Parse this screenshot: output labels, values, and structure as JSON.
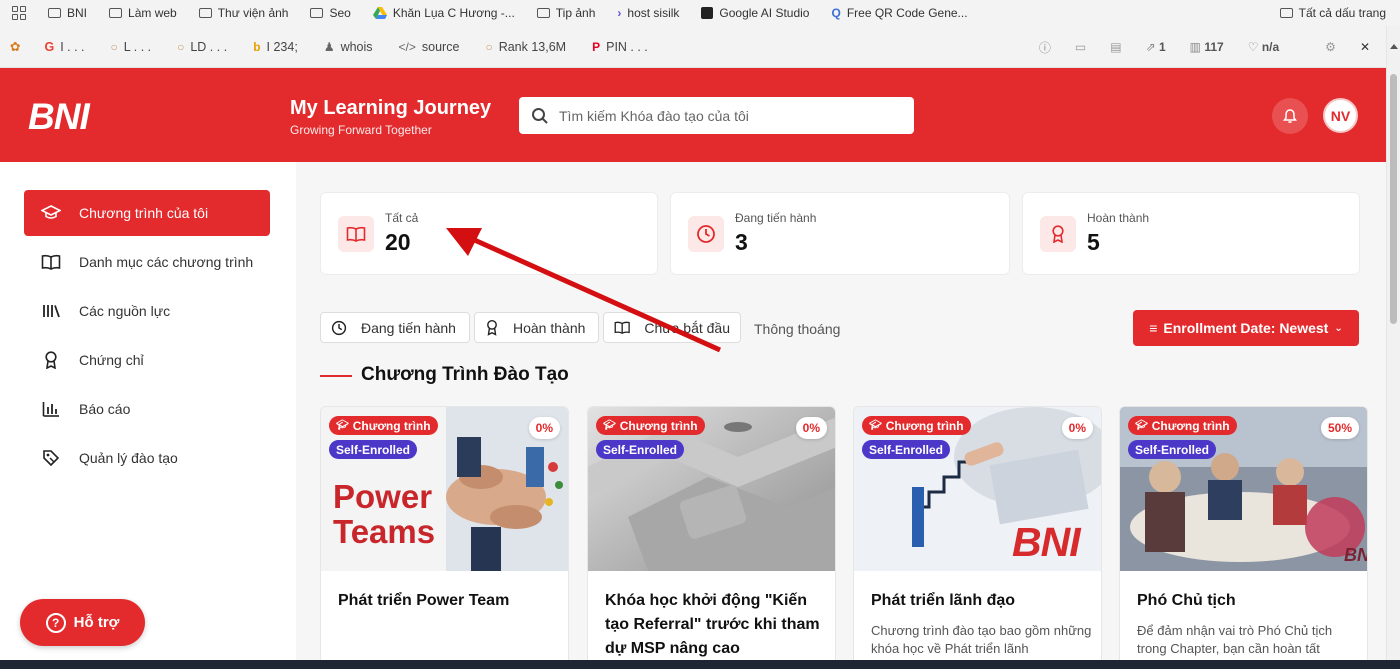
{
  "bookmarks": [
    {
      "label": "BNI",
      "icon": "folder-icon"
    },
    {
      "label": "Làm web",
      "icon": "folder-icon"
    },
    {
      "label": "Thư viện ảnh",
      "icon": "folder-icon"
    },
    {
      "label": "Seo",
      "icon": "folder-icon"
    },
    {
      "label": "Khăn Lụa C Hương -...",
      "icon": "drive-icon"
    },
    {
      "label": "Tip ảnh",
      "icon": "folder-icon"
    },
    {
      "label": "host sisilk",
      "icon": "arrow-icon"
    },
    {
      "label": "Google AI Studio",
      "icon": "studio-icon"
    },
    {
      "label": "Free QR Code Gene...",
      "icon": "qr-icon"
    }
  ],
  "bookmarks_all": "Tất cả dấu trang",
  "ext_toolbar": {
    "items": [
      {
        "icon": "google-icon",
        "label": "I . . ."
      },
      {
        "icon": "circle-icon",
        "label": "L . . ."
      },
      {
        "icon": "circle-icon",
        "label": "LD . . ."
      },
      {
        "icon": "b-icon",
        "label": "I 234;"
      },
      {
        "icon": "person-icon",
        "label": "whois"
      },
      {
        "icon": "code-icon",
        "label": "source"
      },
      {
        "icon": "circle-icon",
        "label": "Rank 13,6M"
      },
      {
        "icon": "pinterest-icon",
        "label": "PIN . . ."
      }
    ],
    "right": [
      {
        "icon": "info-icon",
        "label": ""
      },
      {
        "icon": "monitor-icon",
        "label": ""
      },
      {
        "icon": "doc-icon",
        "label": ""
      },
      {
        "icon": "external-icon",
        "label": "1"
      },
      {
        "icon": "chart-icon",
        "label": "117"
      },
      {
        "icon": "heart-icon",
        "label": "n/a"
      },
      {
        "icon": "gear-icon",
        "label": ""
      },
      {
        "icon": "close-icon",
        "label": "✕"
      }
    ]
  },
  "header": {
    "logo": "BNI",
    "title": "My Learning Journey",
    "subtitle": "Growing Forward Together",
    "search_placeholder": "Tìm kiếm Khóa đào tạo của tôi",
    "avatar_initials": "NV",
    "brand_color": "#e32a2c"
  },
  "sidebar": {
    "items": [
      {
        "label": "Chương trình của tôi",
        "icon": "graduation-cap-icon",
        "active": true
      },
      {
        "label": "Danh mục các chương trình",
        "icon": "book-open-icon",
        "active": false
      },
      {
        "label": "Các nguồn lực",
        "icon": "library-icon",
        "active": false
      },
      {
        "label": "Chứng chỉ",
        "icon": "award-icon",
        "active": false
      },
      {
        "label": "Báo cáo",
        "icon": "bar-chart-icon",
        "active": false
      },
      {
        "label": "Quản lý đào tạo",
        "icon": "tag-icon",
        "active": false
      }
    ],
    "help_label": "Hỗ trợ"
  },
  "stats": [
    {
      "label": "Tất cả",
      "value": "20",
      "icon": "book-open-icon"
    },
    {
      "label": "Đang tiến hành",
      "value": "3",
      "icon": "clock-icon"
    },
    {
      "label": "Hoàn thành",
      "value": "5",
      "icon": "award-icon"
    }
  ],
  "filters": [
    {
      "label": "Đang tiến hành",
      "icon": "clock-icon"
    },
    {
      "label": "Hoàn thành",
      "icon": "award-icon"
    },
    {
      "label": "Chưa bắt đầu",
      "icon": "book-open-icon"
    }
  ],
  "filter_extra": "Thông thoáng",
  "sort_label": "Enrollment Date: Newest",
  "section_title": "Chương Trình Đào Tạo",
  "cards": [
    {
      "tag": "Chương trình",
      "enroll": "Self-Enrolled",
      "percent": "0%",
      "image_text_1": "Power",
      "image_text_2": "Teams",
      "title": "Phát triển Power Team",
      "desc": ""
    },
    {
      "tag": "Chương trình",
      "enroll": "Self-Enrolled",
      "percent": "0%",
      "title": "Khóa học khởi động \"Kiến tạo Referral\" trước khi tham dự MSP nâng cao",
      "desc": ""
    },
    {
      "tag": "Chương trình",
      "enroll": "Self-Enrolled",
      "percent": "0%",
      "image_text_1": "BNI",
      "title": "Phát triển lãnh đạo",
      "desc": "Chương trình đào tạo bao gồm những khóa học về Phát triển lãnh"
    },
    {
      "tag": "Chương trình",
      "enroll": "Self-Enrolled",
      "percent": "50%",
      "image_text_1": "BN",
      "title": "Phó Chủ tịch",
      "desc": "Để đảm nhận vai trò Phó Chủ tịch trong Chapter, bạn cần hoàn tất"
    }
  ]
}
